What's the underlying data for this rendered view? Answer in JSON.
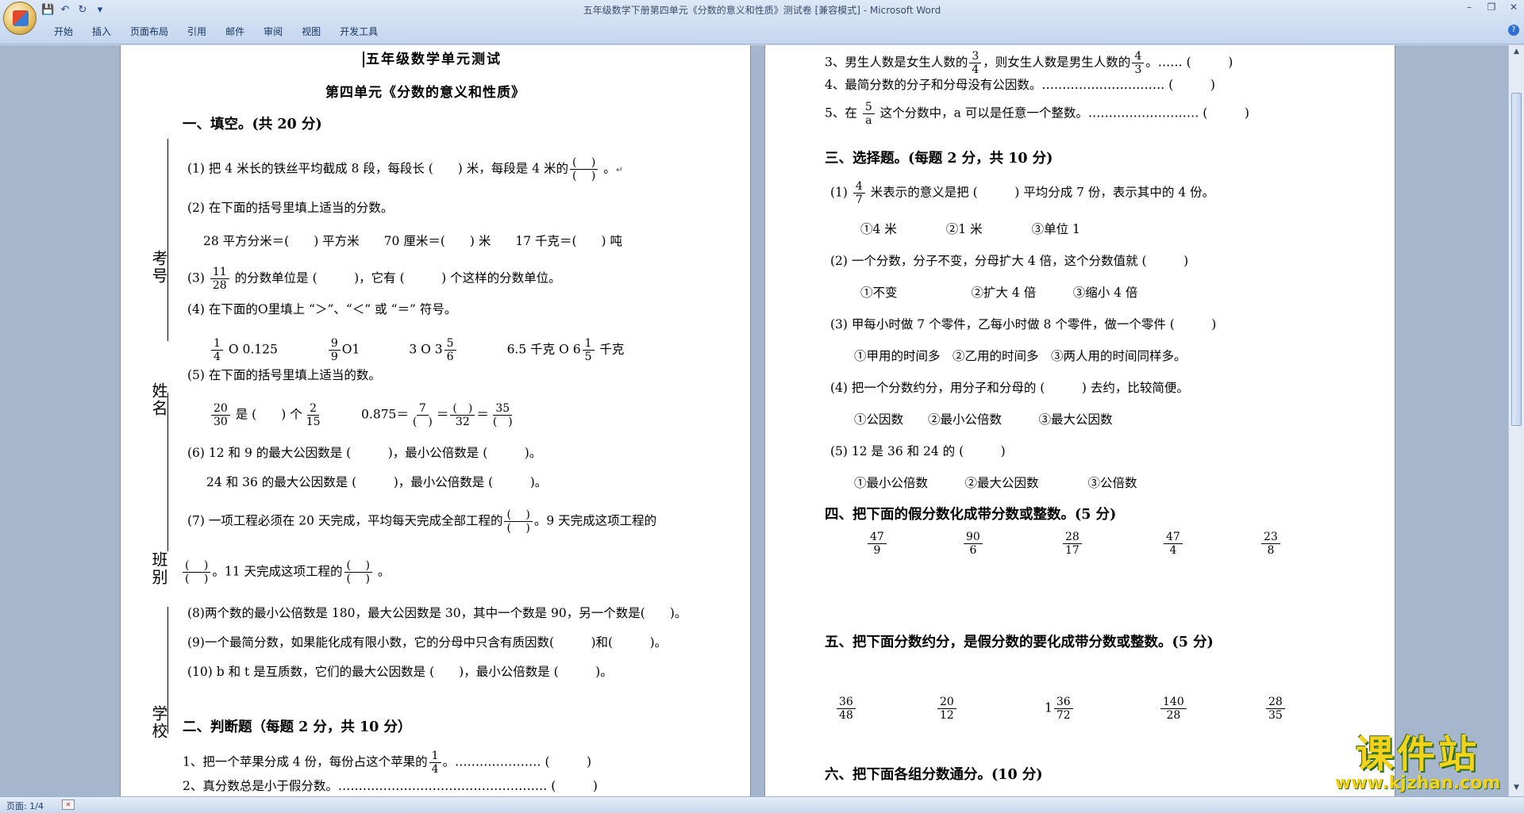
{
  "window": {
    "title": "五年级数学下册第四单元《分数的意义和性质》测试卷 [兼容模式] - Microsoft Word"
  },
  "qat": {
    "save": "💾",
    "undo": "↶",
    "redo": "↻",
    "more": "▾"
  },
  "ribbon": {
    "tabs": [
      "开始",
      "插入",
      "页面布局",
      "引用",
      "邮件",
      "审阅",
      "视图",
      "开发工具"
    ]
  },
  "status": {
    "page": "页面: 1/4"
  },
  "watermark": {
    "big": "课件站",
    "url": "www.kjzhan.com"
  },
  "page1": {
    "title": "五年级数学单元测试",
    "subtitle": "第四单元《分数的意义和性质》",
    "s1": "一、填空。(共 20 分)",
    "q1": "(1) 把 4 米长的铁丝平均截成 8 段，每段长 (　　) 米，每段是 4 米的",
    "q2": "(2) 在下面的括号里填上适当的分数。",
    "q2a": "28 平方分米＝(　　) 平方米　　70 厘米＝(　　) 米　　17 千克＝(　　) 吨",
    "q3a": "的分数单位是 (　　　)，它有 (　　　) 个这样的分数单位。",
    "q4": "(4) 在下面的O里填上 “＞”、“＜” 或 “＝” 符号。",
    "q5": "(5) 在下面的括号里填上适当的数。",
    "q6a": "(6) 12 和 9 的最大公因数是 (　　　)，最小公倍数是 (　　　)。",
    "q6b": "24 和 36 的最大公因数是 (　　　)，最小公倍数是 (　　　)。",
    "q7a": "(7) 一项工程必须在 20 天完成，平均每天完成全部工程的",
    "q7b": "。9 天完成这项工程的",
    "q7c": "。11 天完成这项工程的",
    "q8": "(8)两个数的最小公倍数是 180，最大公因数是 30，其中一个数是 90，另一个数是(　　)。",
    "q9": "(9)一个最简分数，如果能化成有限小数，它的分母中只含有质因数(　　　)和(　　　)。",
    "q10": "(10) b 和 t 是互质数，它们的最大公因数是 (　　)，最小公倍数是 (　　　)。",
    "s2": "二、判断题（每题 2 分，共 10 分）",
    "j1": "1、把一个苹果分成 4 份，每份占这个苹果的",
    "j1b": "。………………… (　　　)",
    "j2": "2、真分数总是小于假分数。…………………………………………… (　　　)",
    "side": {
      "kaohao": "考号",
      "xingming": "姓名",
      "banbie": "班别",
      "xuexiao": "学校"
    }
  },
  "page2": {
    "j3a": "3、男生人数是女生人数的",
    "j3b": "，则女生人数是男生人数的",
    "j3c": "。…… (　　　)",
    "j4": "4、最简分数的分子和分母没有公因数。………………………… (　　　)",
    "j5a": "5、在",
    "j5b": "这个分数中，a 可以是任意一个整数。……………………… (　　　)",
    "s3": "三、选择题。(每题 2 分，共 10 分)",
    "c1": "米表示的意义是把 (　　　) 平均分成 7 份，表示其中的 4 份。",
    "c1o": "①4 米　　　　②1 米　　　　③单位 1",
    "c2": "(2) 一个分数，分子不变，分母扩大 4 倍，这个分数值就 (　　　)",
    "c2o": "①不变　　　　　　②扩大 4 倍　　　③缩小 4 倍",
    "c3": "(3) 甲每小时做 7 个零件，乙每小时做 8 个零件，做一个零件 (　　　)",
    "c3o": "①甲用的时间多　②乙用的时间多　③两人用的时间同样多。",
    "c4": "(4) 把一个分数约分，用分子和分母的 (　　　) 去约，比较简便。",
    "c4o": "①公因数　　②最小公倍数　　　③最大公因数",
    "c5": "(5) 12 是 36 和 24 的 (　　　)",
    "c5o": "①最小公倍数　　　②最大公因数　　　　③公倍数",
    "s4": "四、把下面的假分数化成带分数或整数。(5 分)",
    "s5": "五、把下面分数约分，是假分数的要化成带分数或整数。(5 分)",
    "s6": "六、把下面各组分数通分。(10 分)"
  }
}
